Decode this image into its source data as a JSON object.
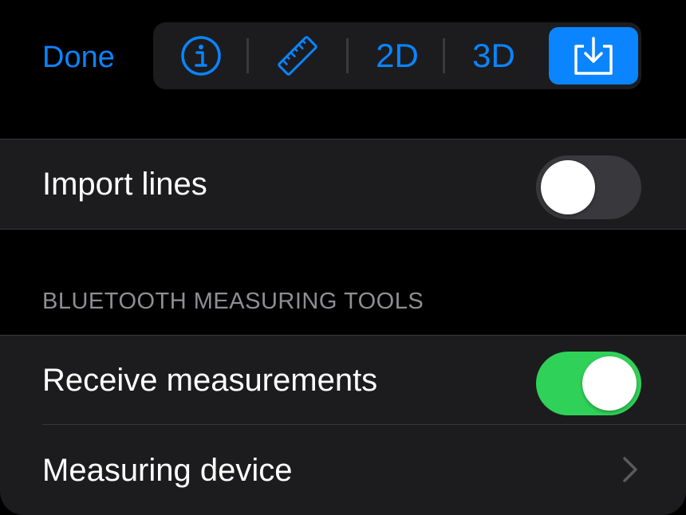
{
  "header": {
    "done_label": "Done",
    "toolbar": {
      "info_icon": "info-circle-icon",
      "ruler_icon": "ruler-icon",
      "label_2d": "2D",
      "label_3d": "3D",
      "import_icon": "tray-arrow-down-icon",
      "selected": "import"
    }
  },
  "settings": {
    "import_lines": {
      "label": "Import lines",
      "enabled": false
    },
    "bluetooth": {
      "section_title": "BLUETOOTH MEASURING TOOLS",
      "receive_measurements": {
        "label": "Receive measurements",
        "enabled": true
      },
      "measuring_device": {
        "label": "Measuring device"
      }
    }
  },
  "colors": {
    "accent": "#0A84FF",
    "toggle_on": "#30D158",
    "toggle_off": "#39393D",
    "row_background": "#1C1C1E",
    "secondary_text": "#8E8E93"
  }
}
